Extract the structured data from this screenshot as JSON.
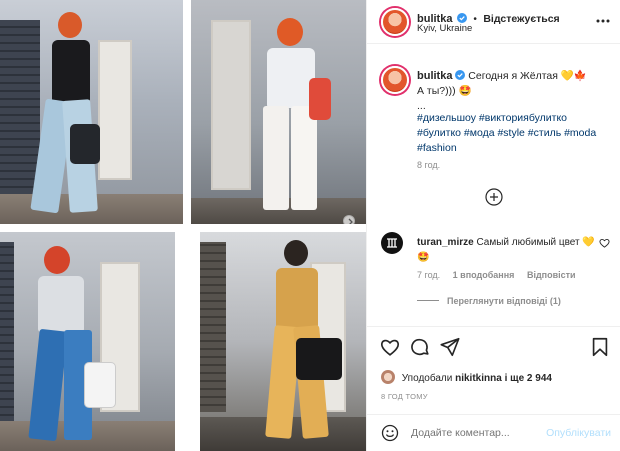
{
  "post": {
    "username": "bulitka",
    "separator": "•",
    "follow_label": "Відстежується",
    "location": "Kyiv, Ukraine",
    "caption_user": "bulitka",
    "caption_line1": "Сегодня я Жёлтая 💛🍁",
    "caption_line2": "А ты?))) 🤩",
    "caption_line3": "...",
    "hashtags": "#дизельшоу #викториябулитко #булитко #мода #style #стиль #moda #fashion",
    "time_ago": "8 год."
  },
  "comment": {
    "username": "turan_mirze",
    "text": "Самый любимый цвет 💛🤩",
    "time": "7 год.",
    "likes": "1 вподобання",
    "reply": "Відповісти",
    "view_replies": "Переглянути відповіді (1)"
  },
  "likes_line": {
    "prefix": "Уподобали",
    "user": "nikitkinna",
    "suffix": "і ще 2 944"
  },
  "posted_ago": "8 ГОД ТОМУ",
  "add_comment": {
    "placeholder": "Додайте коментар...",
    "publish": "Опублікувати"
  },
  "icons": [
    "more-icon",
    "verified-icon",
    "add-more-icon",
    "heart-icon",
    "comment-icon",
    "share-icon",
    "save-icon",
    "emoji-icon"
  ],
  "colors": {
    "link": "#00376b",
    "muted": "#8e8e8e",
    "publish_disabled": "#b2dffc",
    "verified": "#3897f0"
  }
}
